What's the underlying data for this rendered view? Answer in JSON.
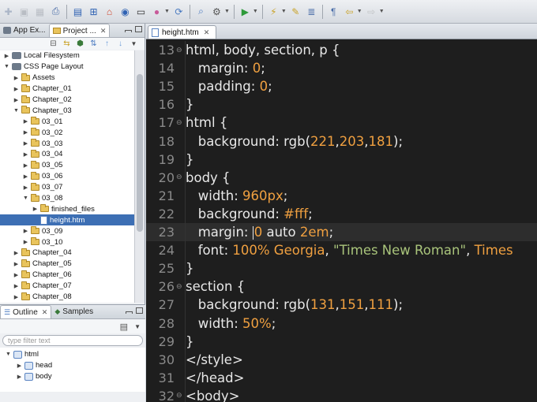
{
  "toolbar": {
    "icons": [
      "new-icon",
      "save-icon",
      "save-all-icon",
      "print-icon",
      "perspective-icon",
      "hierarchy-icon",
      "home-icon",
      "web-icon",
      "monitor-icon",
      "color-icon",
      "refresh-icon",
      "search-icon",
      "gear-icon",
      "run-icon",
      "wand-icon",
      "edit-icon",
      "list-icon",
      "paragraph-icon",
      "back-icon",
      "forward-icon"
    ]
  },
  "left_tabs": {
    "app_explorer": "App Ex...",
    "project_explorer": "Project ..."
  },
  "tree": [
    {
      "label": "Local Filesystem",
      "indent": 0,
      "type": "proj",
      "twisty": "▶"
    },
    {
      "label": "CSS Page Layout",
      "indent": 0,
      "type": "proj",
      "twisty": "▼"
    },
    {
      "label": "Assets",
      "indent": 1,
      "type": "folder",
      "twisty": "▶"
    },
    {
      "label": "Chapter_01",
      "indent": 1,
      "type": "folder",
      "twisty": "▶"
    },
    {
      "label": "Chapter_02",
      "indent": 1,
      "type": "folder",
      "twisty": "▶"
    },
    {
      "label": "Chapter_03",
      "indent": 1,
      "type": "folder",
      "twisty": "▼"
    },
    {
      "label": "03_01",
      "indent": 2,
      "type": "folder",
      "twisty": "▶"
    },
    {
      "label": "03_02",
      "indent": 2,
      "type": "folder",
      "twisty": "▶"
    },
    {
      "label": "03_03",
      "indent": 2,
      "type": "folder",
      "twisty": "▶"
    },
    {
      "label": "03_04",
      "indent": 2,
      "type": "folder",
      "twisty": "▶"
    },
    {
      "label": "03_05",
      "indent": 2,
      "type": "folder",
      "twisty": "▶"
    },
    {
      "label": "03_06",
      "indent": 2,
      "type": "folder",
      "twisty": "▶"
    },
    {
      "label": "03_07",
      "indent": 2,
      "type": "folder",
      "twisty": "▶"
    },
    {
      "label": "03_08",
      "indent": 2,
      "type": "folder",
      "twisty": "▼"
    },
    {
      "label": "finished_files",
      "indent": 3,
      "type": "folder",
      "twisty": "▶"
    },
    {
      "label": "height.htm",
      "indent": 3,
      "type": "file",
      "twisty": "",
      "selected": true
    },
    {
      "label": "03_09",
      "indent": 2,
      "type": "folder",
      "twisty": "▶"
    },
    {
      "label": "03_10",
      "indent": 2,
      "type": "folder",
      "twisty": "▶"
    },
    {
      "label": "Chapter_04",
      "indent": 1,
      "type": "folder",
      "twisty": "▶"
    },
    {
      "label": "Chapter_05",
      "indent": 1,
      "type": "folder",
      "twisty": "▶"
    },
    {
      "label": "Chapter_06",
      "indent": 1,
      "type": "folder",
      "twisty": "▶"
    },
    {
      "label": "Chapter_07",
      "indent": 1,
      "type": "folder",
      "twisty": "▶"
    },
    {
      "label": "Chapter_08",
      "indent": 1,
      "type": "folder",
      "twisty": "▶"
    }
  ],
  "outline": {
    "tab_outline": "Outline",
    "tab_samples": "Samples",
    "filter_placeholder": "type filter text",
    "nodes": [
      {
        "label": "html",
        "indent": 0,
        "twisty": "▼"
      },
      {
        "label": "head",
        "indent": 1,
        "twisty": "▶"
      },
      {
        "label": "body",
        "indent": 1,
        "twisty": "▶"
      }
    ]
  },
  "editor": {
    "tab_label": "height.htm",
    "current_line": 23,
    "lines": [
      {
        "n": "13",
        "fold": true,
        "tokens": [
          {
            "t": "html, body, section, p {",
            "c": "sel"
          }
        ]
      },
      {
        "n": "14",
        "tokens": [
          {
            "t": "   margin: ",
            "c": "prop"
          },
          {
            "t": "0",
            "c": "val"
          },
          {
            "t": ";",
            "c": "punc"
          }
        ]
      },
      {
        "n": "15",
        "tokens": [
          {
            "t": "   padding: ",
            "c": "prop"
          },
          {
            "t": "0",
            "c": "val"
          },
          {
            "t": ";",
            "c": "punc"
          }
        ]
      },
      {
        "n": "16",
        "tokens": [
          {
            "t": "}",
            "c": "punc"
          }
        ]
      },
      {
        "n": "17",
        "fold": true,
        "tokens": [
          {
            "t": "html {",
            "c": "sel"
          }
        ]
      },
      {
        "n": "18",
        "tokens": [
          {
            "t": "   background: rgb(",
            "c": "prop"
          },
          {
            "t": "221",
            "c": "val"
          },
          {
            "t": ",",
            "c": "punc"
          },
          {
            "t": "203",
            "c": "val"
          },
          {
            "t": ",",
            "c": "punc"
          },
          {
            "t": "181",
            "c": "val"
          },
          {
            "t": ");",
            "c": "punc"
          }
        ]
      },
      {
        "n": "19",
        "tokens": [
          {
            "t": "}",
            "c": "punc"
          }
        ]
      },
      {
        "n": "20",
        "fold": true,
        "tokens": [
          {
            "t": "body {",
            "c": "sel"
          }
        ]
      },
      {
        "n": "21",
        "tokens": [
          {
            "t": "   width: ",
            "c": "prop"
          },
          {
            "t": "960px",
            "c": "val"
          },
          {
            "t": ";",
            "c": "punc"
          }
        ]
      },
      {
        "n": "22",
        "tokens": [
          {
            "t": "   background: ",
            "c": "prop"
          },
          {
            "t": "#fff",
            "c": "val"
          },
          {
            "t": ";",
            "c": "punc"
          }
        ]
      },
      {
        "n": "23",
        "caret": true,
        "tokens": [
          {
            "t": "   margin: ",
            "c": "prop"
          },
          {
            "t": "CARET",
            "c": "caret"
          },
          {
            "t": "0",
            "c": "val"
          },
          {
            "t": " auto ",
            "c": "prop"
          },
          {
            "t": "2em",
            "c": "val"
          },
          {
            "t": ";",
            "c": "punc"
          }
        ]
      },
      {
        "n": "24",
        "tokens": [
          {
            "t": "   font: ",
            "c": "prop"
          },
          {
            "t": "100% Georgia",
            "c": "val"
          },
          {
            "t": ", ",
            "c": "punc"
          },
          {
            "t": "\"Times New Roman\"",
            "c": "str"
          },
          {
            "t": ", ",
            "c": "punc"
          },
          {
            "t": "Times",
            "c": "val"
          }
        ]
      },
      {
        "n": "25",
        "tokens": [
          {
            "t": "}",
            "c": "punc"
          }
        ]
      },
      {
        "n": "26",
        "fold": true,
        "tokens": [
          {
            "t": "section {",
            "c": "sel"
          }
        ]
      },
      {
        "n": "27",
        "tokens": [
          {
            "t": "   background: rgb(",
            "c": "prop"
          },
          {
            "t": "131",
            "c": "val"
          },
          {
            "t": ",",
            "c": "punc"
          },
          {
            "t": "151",
            "c": "val"
          },
          {
            "t": ",",
            "c": "punc"
          },
          {
            "t": "111",
            "c": "val"
          },
          {
            "t": ");",
            "c": "punc"
          }
        ]
      },
      {
        "n": "28",
        "tokens": [
          {
            "t": "   width: ",
            "c": "prop"
          },
          {
            "t": "50%",
            "c": "val"
          },
          {
            "t": ";",
            "c": "punc"
          }
        ]
      },
      {
        "n": "29",
        "tokens": [
          {
            "t": "}",
            "c": "punc"
          }
        ]
      },
      {
        "n": "30",
        "tokens": [
          {
            "t": "</style>",
            "c": "tagc"
          }
        ]
      },
      {
        "n": "31",
        "tokens": [
          {
            "t": "</head>",
            "c": "tagc"
          }
        ]
      },
      {
        "n": "32",
        "fold": true,
        "tokens": [
          {
            "t": "<body>",
            "c": "tagc"
          }
        ]
      }
    ]
  },
  "colors": {
    "editor_bg": "#1e1e1e",
    "value_orange": "#f0a040",
    "string_green": "#a9c47b",
    "selection_blue": "#3d6fb4"
  }
}
